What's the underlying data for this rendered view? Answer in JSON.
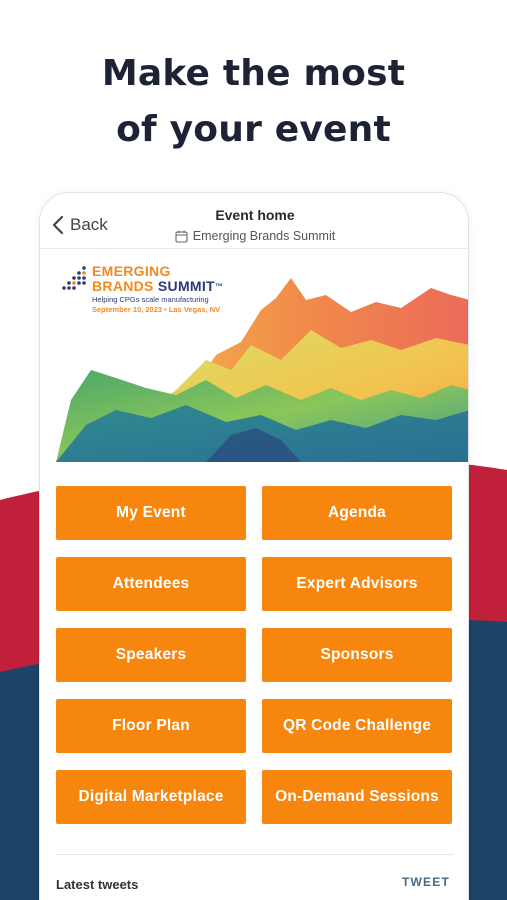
{
  "headline": {
    "line1": "Make the most",
    "line2": "of your event"
  },
  "nav": {
    "back_label": "Back",
    "title": "Event home",
    "subtitle": "Emerging Brands Summit"
  },
  "banner_logo": {
    "line1": "EMERGING",
    "line2_a": "BRANDS ",
    "line2_b": "SUMMIT",
    "trademark": "™",
    "tagline": "Helping CPGs scale manufacturing",
    "date": "September 10, 2023 • Las Vegas, NV"
  },
  "tiles": [
    {
      "label": "My Event"
    },
    {
      "label": "Agenda"
    },
    {
      "label": "Attendees"
    },
    {
      "label": "Expert Advisors"
    },
    {
      "label": "Speakers"
    },
    {
      "label": "Sponsors"
    },
    {
      "label": "Floor Plan"
    },
    {
      "label": "QR Code Challenge"
    },
    {
      "label": "Digital Marketplace"
    },
    {
      "label": "On-Demand Sessions"
    }
  ],
  "tweets": {
    "heading": "Latest tweets",
    "action_label": "TWEET"
  },
  "colors": {
    "accent": "#f7860f",
    "brand_navy": "#1e2235",
    "wave_red": "#c1203a",
    "wave_navy": "#1c4466"
  },
  "icons": {
    "back": "chevron-left-icon",
    "subtitle": "calendar-icon",
    "logo": "dot-grid-logo"
  }
}
